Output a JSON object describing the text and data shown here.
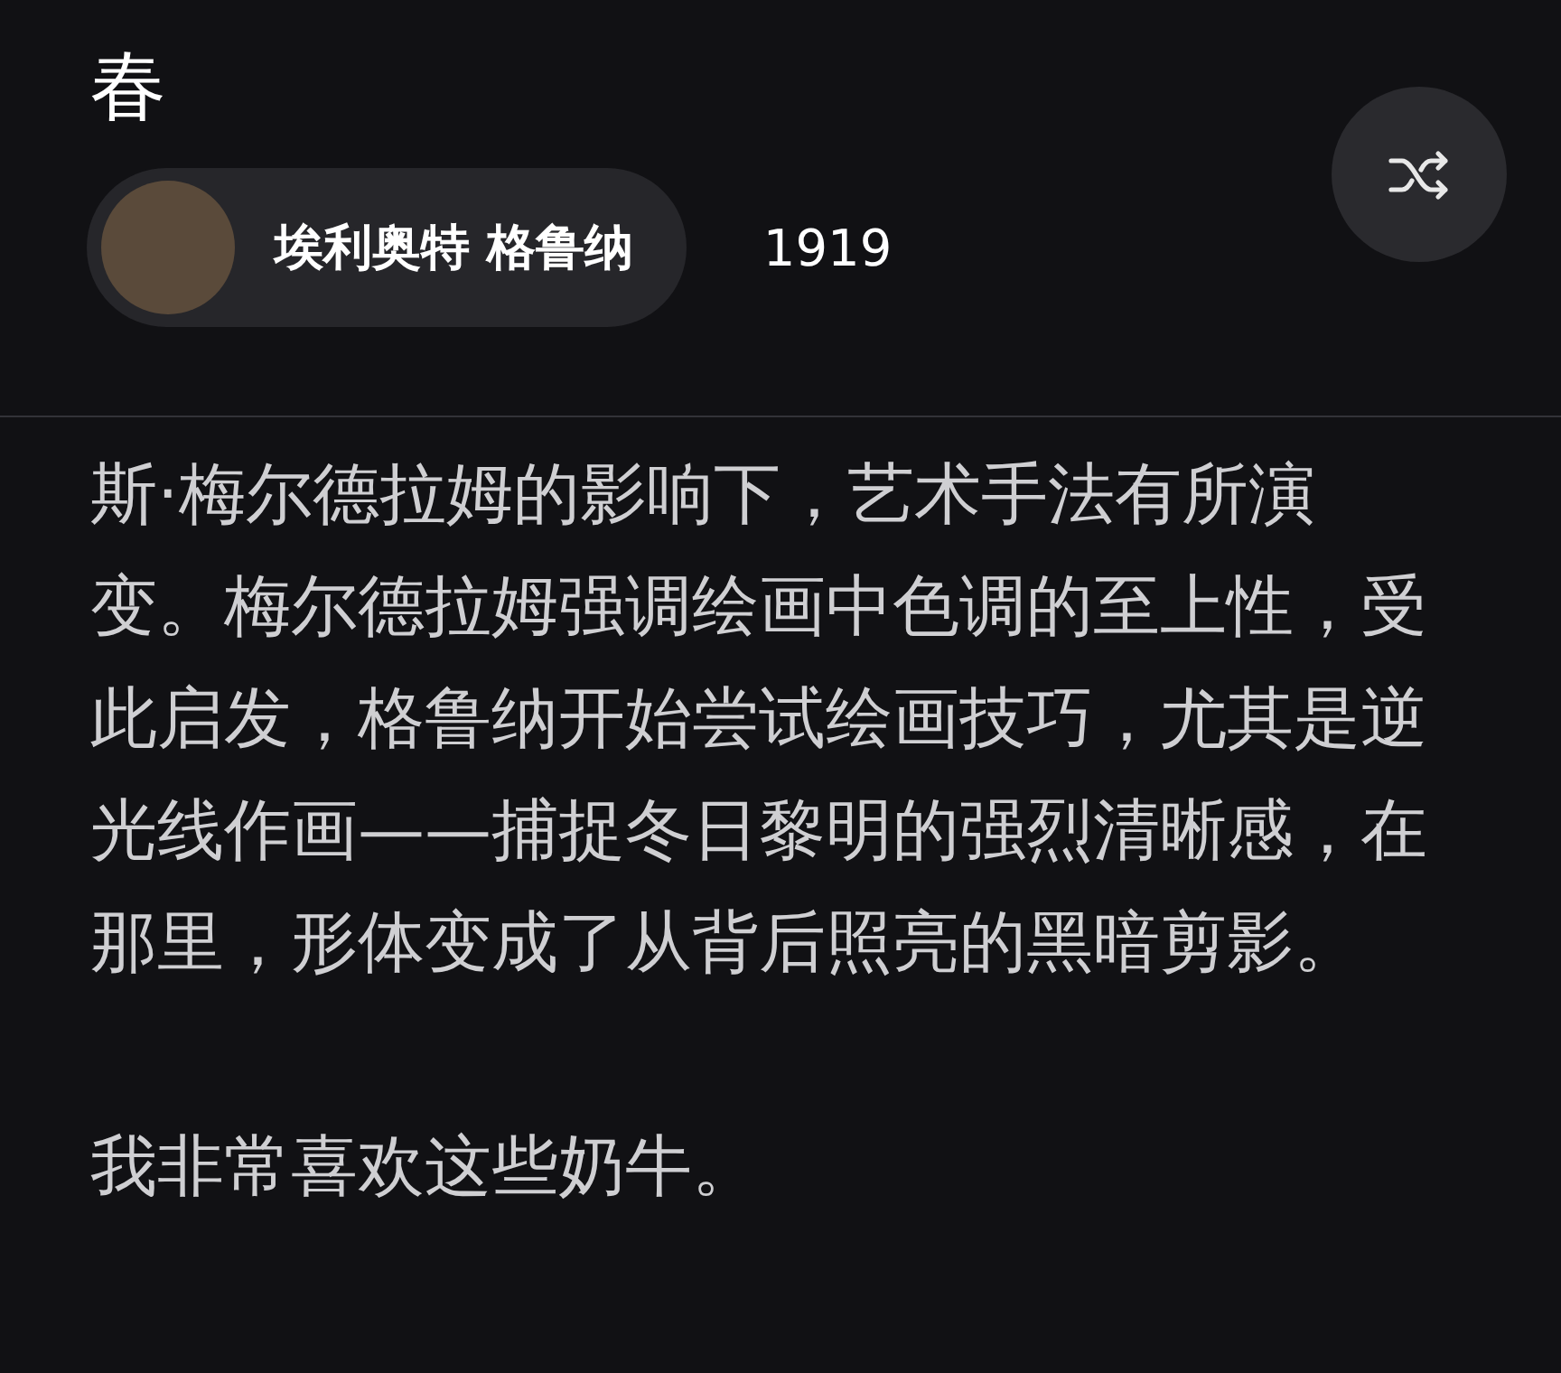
{
  "title": "春",
  "artist": {
    "name": "埃利奥特 格鲁纳",
    "year": "1919"
  },
  "paragraphs": [
    "斯·梅尔德拉姆的影响下，艺术手法有所演变。梅尔德拉姆强调绘画中色调的至上性，受此启发，格鲁纳开始尝试绘画技巧，尤其是逆光线作画——捕捉冬日黎明的强烈清晰感，在那里，形体变成了从背后照亮的黑暗剪影。",
    "我非常喜欢这些奶牛。"
  ]
}
